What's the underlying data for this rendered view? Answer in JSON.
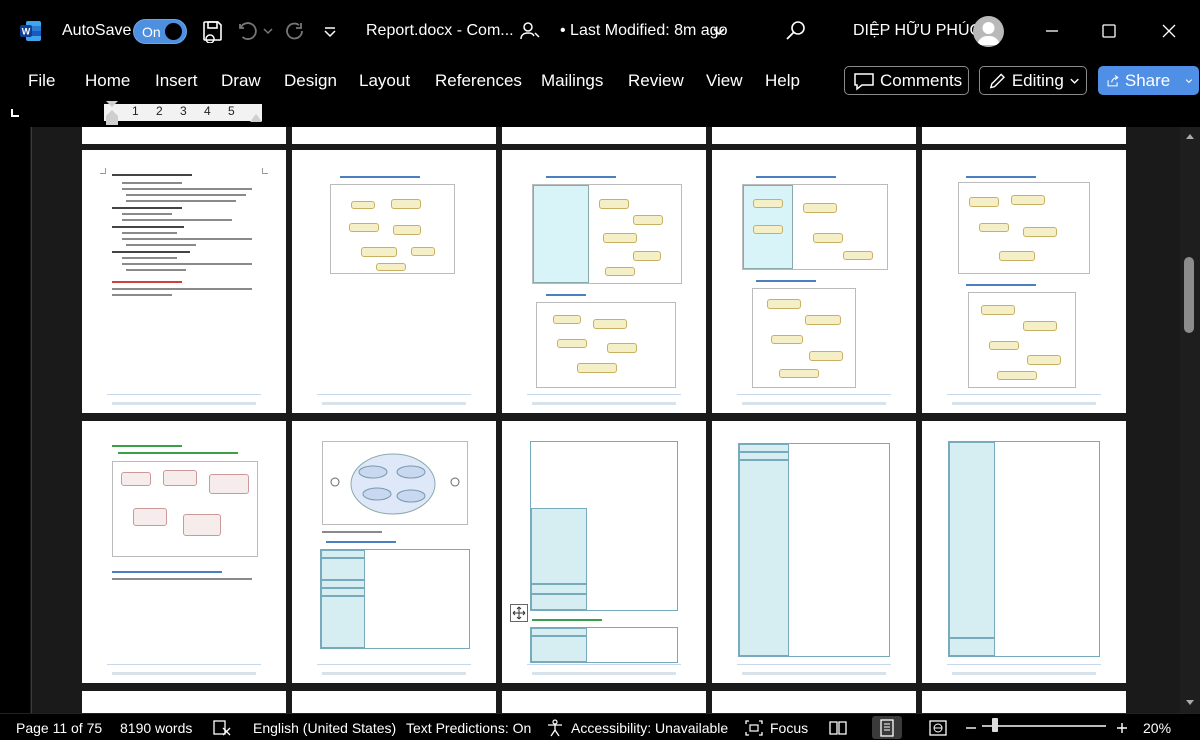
{
  "titlebar": {
    "autosave_label": "AutoSave",
    "autosave_state": "On",
    "document_title": "Report.docx  -  Com...",
    "modified_text": "• Last Modified: 8m ago",
    "user_name": "DIỆP HỮU PHÚC"
  },
  "ribbon": {
    "tabs": [
      "File",
      "Home",
      "Insert",
      "Draw",
      "Design",
      "Layout",
      "References",
      "Mailings",
      "Review",
      "View",
      "Help"
    ],
    "comments_label": "Comments",
    "editing_label": "Editing",
    "share_label": "Share"
  },
  "ruler": {
    "numbers": [
      "1",
      "2",
      "3",
      "4",
      "5"
    ]
  },
  "statusbar": {
    "page": "Page 11 of 75",
    "words": "8190 words",
    "language": "English (United States)",
    "text_predictions": "Text Predictions: On",
    "accessibility": "Accessibility: Unavailable",
    "focus": "Focus",
    "zoom": "20%"
  },
  "colors": {
    "accent": "#4f8fe6",
    "workspace": "#1a1a1a",
    "page": "#ffffff",
    "table_fill": "#d6eef2"
  }
}
